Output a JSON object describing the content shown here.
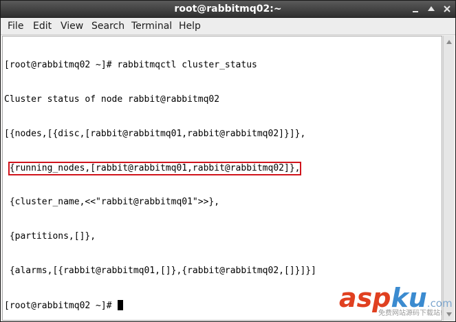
{
  "window": {
    "title": "root@rabbitmq02:~"
  },
  "menu": {
    "items": [
      "File",
      "Edit",
      "View",
      "Search",
      "Terminal",
      "Help"
    ]
  },
  "terminal": {
    "lines": [
      "[root@rabbitmq02 ~]# rabbitmqctl cluster_status",
      "Cluster status of node rabbit@rabbitmq02",
      "[{nodes,[{disc,[rabbit@rabbitmq01,rabbit@rabbitmq02]}]},",
      "{running_nodes,[rabbit@rabbitmq01,rabbit@rabbitmq02]},",
      " {cluster_name,<<\"rabbit@rabbitmq01\">>},",
      " {partitions,[]},",
      " {alarms,[{rabbit@rabbitmq01,[]},{rabbit@rabbitmq02,[]}]}]",
      "[root@rabbitmq02 ~]# "
    ],
    "highlight_color": "#d0141c",
    "text_color": "#000000",
    "background": "#ffffff"
  },
  "icons": {
    "minimize": "minimize-icon",
    "maximize": "maximize-icon",
    "close": "close-icon",
    "scroll_up": "chevron-up-icon",
    "scroll_down": "chevron-down-icon"
  },
  "watermark": {
    "brand_a": "asp",
    "brand_ku": "ku",
    "brand_com": ".com",
    "subtitle": "免费网站源码下载站!"
  }
}
